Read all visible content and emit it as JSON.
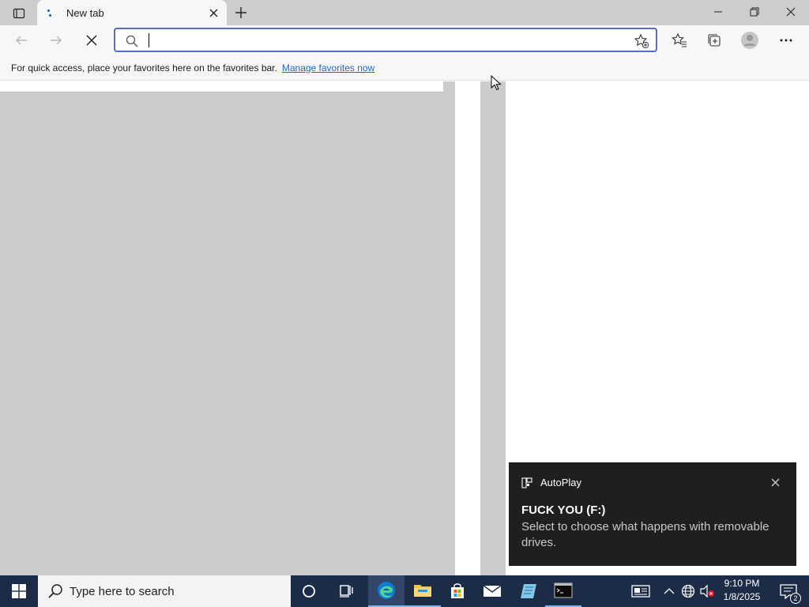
{
  "browser": {
    "tab": {
      "title": "New tab",
      "close_icon": "close-icon"
    },
    "new_tab_icon": "plus-icon",
    "window_controls": [
      "minimize-icon",
      "restore-icon",
      "close-icon"
    ],
    "address_bar": {
      "value": "",
      "placeholder": ""
    },
    "favorites_bar": {
      "message": "For quick access, place your favorites here on the favorites bar.",
      "link": "Manage favorites now"
    }
  },
  "notification": {
    "app": "AutoPlay",
    "title": "FUCK YOU (F:)",
    "body": "Select to choose what happens with removable drives."
  },
  "taskbar": {
    "search_placeholder": "Type here to search",
    "apps": [
      "cortana-icon",
      "task-view-icon",
      "edge-icon",
      "file-explorer-icon",
      "microsoft-store-icon",
      "mail-icon",
      "notepad-icon",
      "terminal-icon"
    ],
    "clock": {
      "time": "9:10 PM",
      "date": "1/8/2025"
    },
    "notification_count": "2"
  },
  "colors": {
    "taskbar": "#1d2c46",
    "address_border": "#5b6dbd",
    "link": "#1a6ad0",
    "toast_bg": "#1f1f1f"
  }
}
